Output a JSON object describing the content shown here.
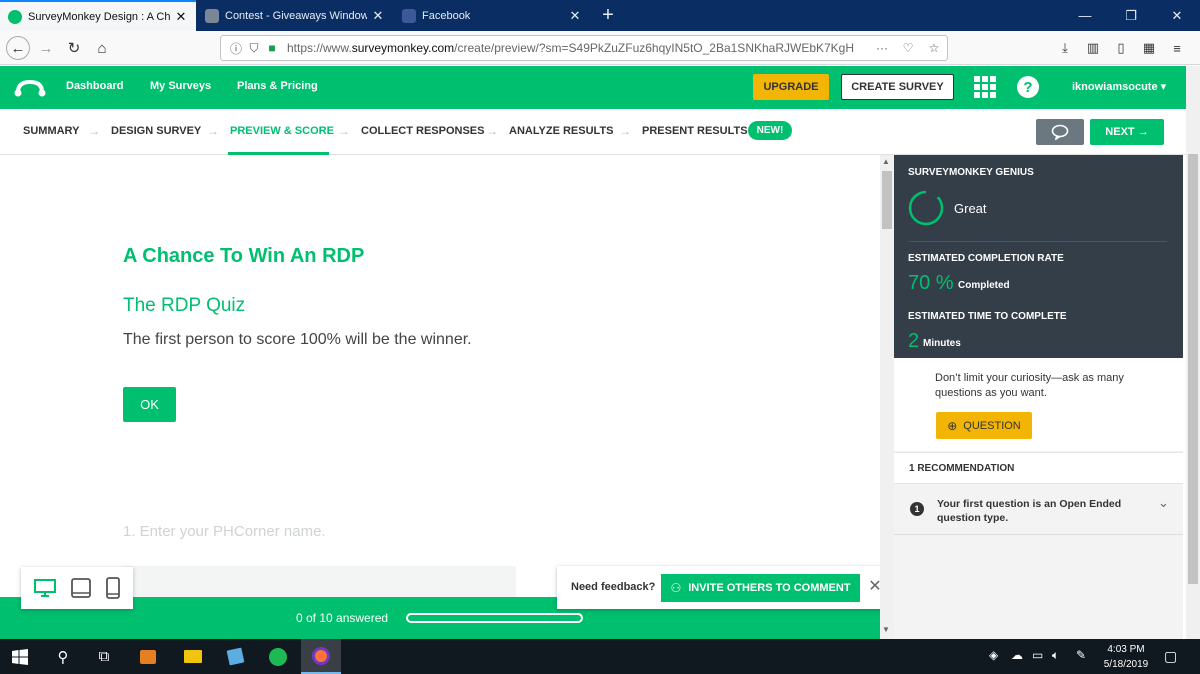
{
  "browser": {
    "tabs": [
      {
        "title": "SurveyMonkey Design : A Char",
        "color": "#00bf6f"
      },
      {
        "title": "Contest - Giveaways Windows",
        "color": "#7a8796"
      },
      {
        "title": "Facebook",
        "color": "#3b5998"
      }
    ],
    "url_prefix": "https://www.",
    "url_domain": "surveymonkey.com",
    "url_rest": "/create/preview/?sm=S49PkZuZFuz6hqyIN5tO_2Ba1SNKhaRJWEbK7KgH",
    "url_more": "···"
  },
  "header": {
    "nav": [
      "Dashboard",
      "My Surveys",
      "Plans & Pricing"
    ],
    "upgrade": "UPGRADE",
    "create": "CREATE SURVEY",
    "help": "?",
    "user": "iknowiamsocute ▾",
    "brand_color": "#00bf6f"
  },
  "steps": {
    "items": [
      "SUMMARY",
      "DESIGN SURVEY",
      "PREVIEW & SCORE",
      "COLLECT RESPONSES",
      "ANALYZE RESULTS",
      "PRESENT RESULTS"
    ],
    "active": "PREVIEW & SCORE",
    "new_badge": "NEW!",
    "next": "NEXT →"
  },
  "survey": {
    "title": "A Chance To Win An RDP",
    "page_title": "The RDP Quiz",
    "description": "The first person to score 100% will be the winner.",
    "ok": "OK",
    "question1": "1. Enter your PHCorner name.",
    "progress_text": "0 of 10 answered",
    "progress_fraction": 0
  },
  "feedback": {
    "label": "Need feedback?",
    "invite": "INVITE OTHERS TO COMMENT",
    "close": "✕"
  },
  "genius": {
    "title": "SURVEYMONKEY GENIUS",
    "rating": "Great",
    "completion_label": "ESTIMATED COMPLETION RATE",
    "completion_value": "70 %",
    "completion_unit": "Completed",
    "time_label": "ESTIMATED TIME TO COMPLETE",
    "time_value": "2",
    "time_unit": "Minutes"
  },
  "sidebar": {
    "tip": "Don’t limit your curiosity—ask as many questions as you want.",
    "question_button": "QUESTION",
    "rec_header": "1 RECOMMENDATION",
    "rec_number": "1",
    "rec_text": "Your first question is an Open Ended question type."
  },
  "taskbar": {
    "time": "4:03 PM",
    "date": "5/18/2019"
  }
}
